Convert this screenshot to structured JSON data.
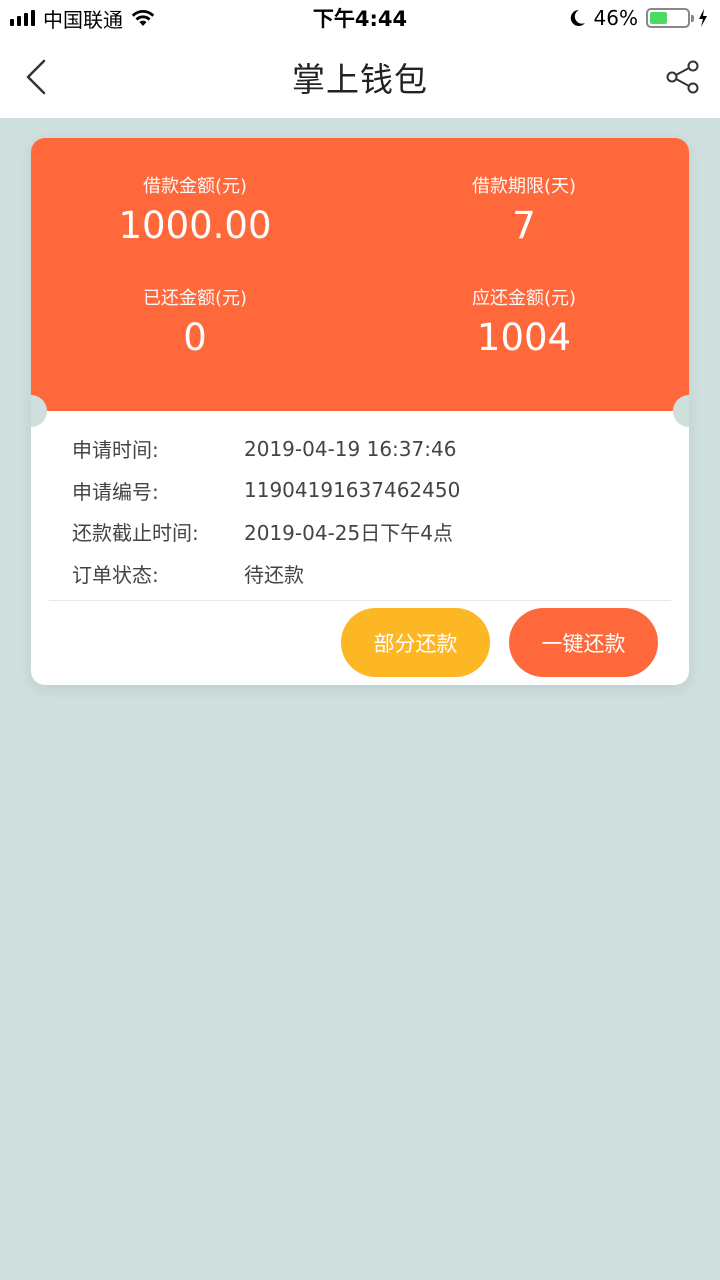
{
  "status_bar": {
    "carrier": "中国联通",
    "time": "下午4:44",
    "battery_percent": "46%",
    "battery_level": 0.46,
    "icons": [
      "signal-icon",
      "wifi-icon",
      "moon-icon",
      "battery-icon",
      "charging-icon"
    ]
  },
  "nav": {
    "title": "掌上钱包",
    "icons": [
      "back-icon",
      "share-icon"
    ]
  },
  "summary": {
    "loan_amount_label": "借款金额(元)",
    "loan_amount": "1000.00",
    "loan_term_label": "借款期限(天)",
    "loan_term": "7",
    "repaid_label": "已还金额(元)",
    "repaid": "0",
    "due_label": "应还金额(元)",
    "due": "1004"
  },
  "details": [
    {
      "label": "申请时间:",
      "value": "2019-04-19 16:37:46"
    },
    {
      "label": "申请编号:",
      "value": "11904191637462450"
    },
    {
      "label": "还款截止时间:",
      "value": "2019-04-25日下午4点"
    },
    {
      "label": "订单状态:",
      "value": "待还款"
    }
  ],
  "actions": {
    "partial_label": "部分还款",
    "full_label": "一键还款"
  },
  "colors": {
    "accent": "#ff683a",
    "partial_button": "#fdb624",
    "background": "#cfdfdd"
  }
}
